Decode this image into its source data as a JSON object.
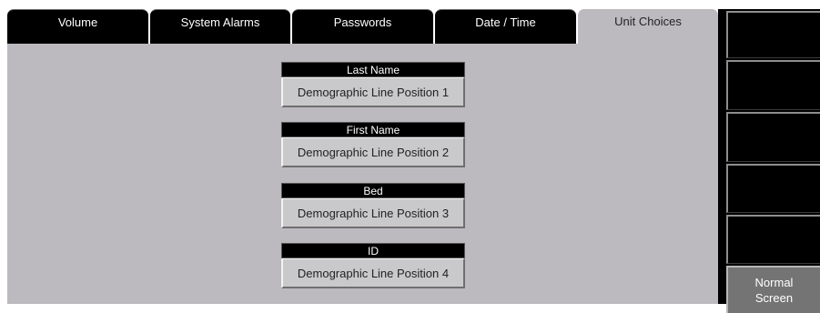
{
  "tabs": [
    {
      "label": "Volume"
    },
    {
      "label": "System Alarms"
    },
    {
      "label": "Passwords"
    },
    {
      "label": "Date / Time"
    },
    {
      "label": "Unit Choices"
    }
  ],
  "active_tab": "Unit Choices",
  "fields": [
    {
      "header": "Last Name",
      "value": "Demographic Line Position 1"
    },
    {
      "header": "First Name",
      "value": "Demographic Line Position 2"
    },
    {
      "header": "Bed",
      "value": "Demographic Line Position 3"
    },
    {
      "header": "ID",
      "value": "Demographic Line Position 4"
    }
  ],
  "side_panel": {
    "normal_screen_line1": "Normal",
    "normal_screen_line2": "Screen"
  },
  "colors": {
    "panel_gray": "#bcbabe",
    "tab_black": "#000000",
    "button_gray": "#747474"
  }
}
